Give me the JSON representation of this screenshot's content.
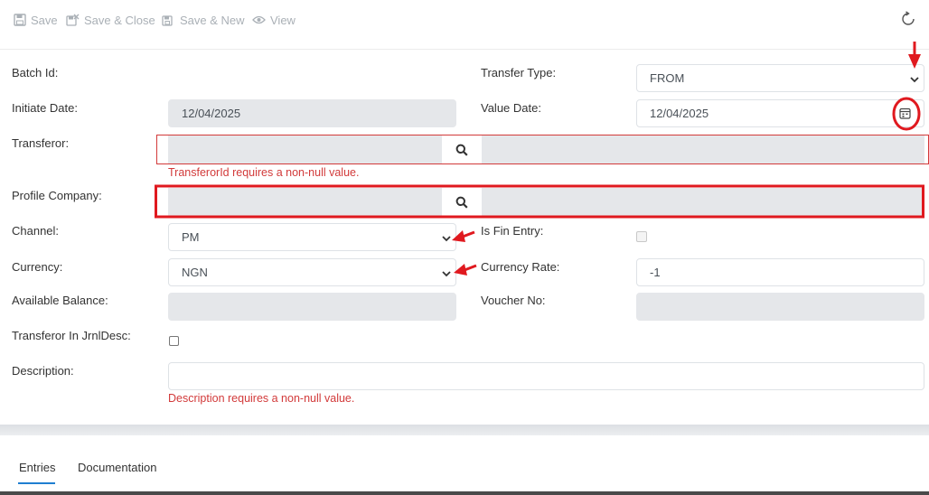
{
  "toolbar": {
    "save_label": "Save",
    "save_close_label": "Save & Close",
    "save_new_label": "Save & New",
    "view_label": "View"
  },
  "form": {
    "batch_id": {
      "label": "Batch Id:"
    },
    "transfer_type": {
      "label": "Transfer Type:",
      "value": "FROM"
    },
    "initiate_date": {
      "label": "Initiate Date:",
      "value": "12/04/2025"
    },
    "value_date": {
      "label": "Value Date:",
      "value": "12/04/2025"
    },
    "transferor": {
      "label": "Transferor:",
      "error": "TransferorId requires a non-null value."
    },
    "profile_company": {
      "label": "Profile Company:"
    },
    "channel": {
      "label": "Channel:",
      "value": "PM"
    },
    "is_fin_entry": {
      "label": "Is Fin Entry:"
    },
    "currency": {
      "label": "Currency:",
      "value": "NGN"
    },
    "currency_rate": {
      "label": "Currency Rate:",
      "value": "-1"
    },
    "available_balance": {
      "label": "Available Balance:"
    },
    "voucher_no": {
      "label": "Voucher No:"
    },
    "transferor_in_jrnl": {
      "label": "Transferor In JrnlDesc:"
    },
    "description": {
      "label": "Description:",
      "error": "Description requires a non-null value."
    }
  },
  "tabs": [
    {
      "label": "Entries"
    },
    {
      "label": "Documentation"
    }
  ],
  "colors": {
    "accent": "#1f7fd1",
    "error": "#d23a3a",
    "annotation": "#e0191f",
    "readonly_bg": "#e5e7ea"
  }
}
